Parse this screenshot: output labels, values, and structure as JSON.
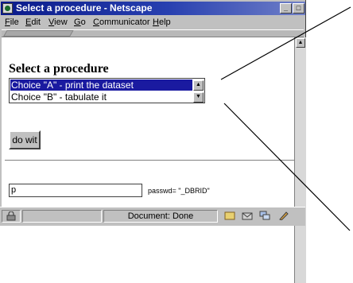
{
  "window": {
    "title": "Select a procedure - Netscape",
    "controls": {
      "minimize": "_",
      "maximize": "□"
    }
  },
  "menu": [
    "File",
    "Edit",
    "View",
    "Go",
    "Communicator",
    "Help"
  ],
  "page": {
    "heading": "Select a procedure",
    "listbox": {
      "options": [
        "Choice \"A\" - print the dataset",
        "Choice \"B\" - tabulate it"
      ],
      "selected_index": 0
    },
    "submit_label": "do wit",
    "text_field_value": "p",
    "text_field_label": "passwd= \"_DBRID\""
  },
  "status": {
    "text": "Document: Done"
  },
  "colors": {
    "title_start": "#0a1a8a",
    "selection": "#1a1aa0",
    "chrome": "#c0c0c0"
  }
}
